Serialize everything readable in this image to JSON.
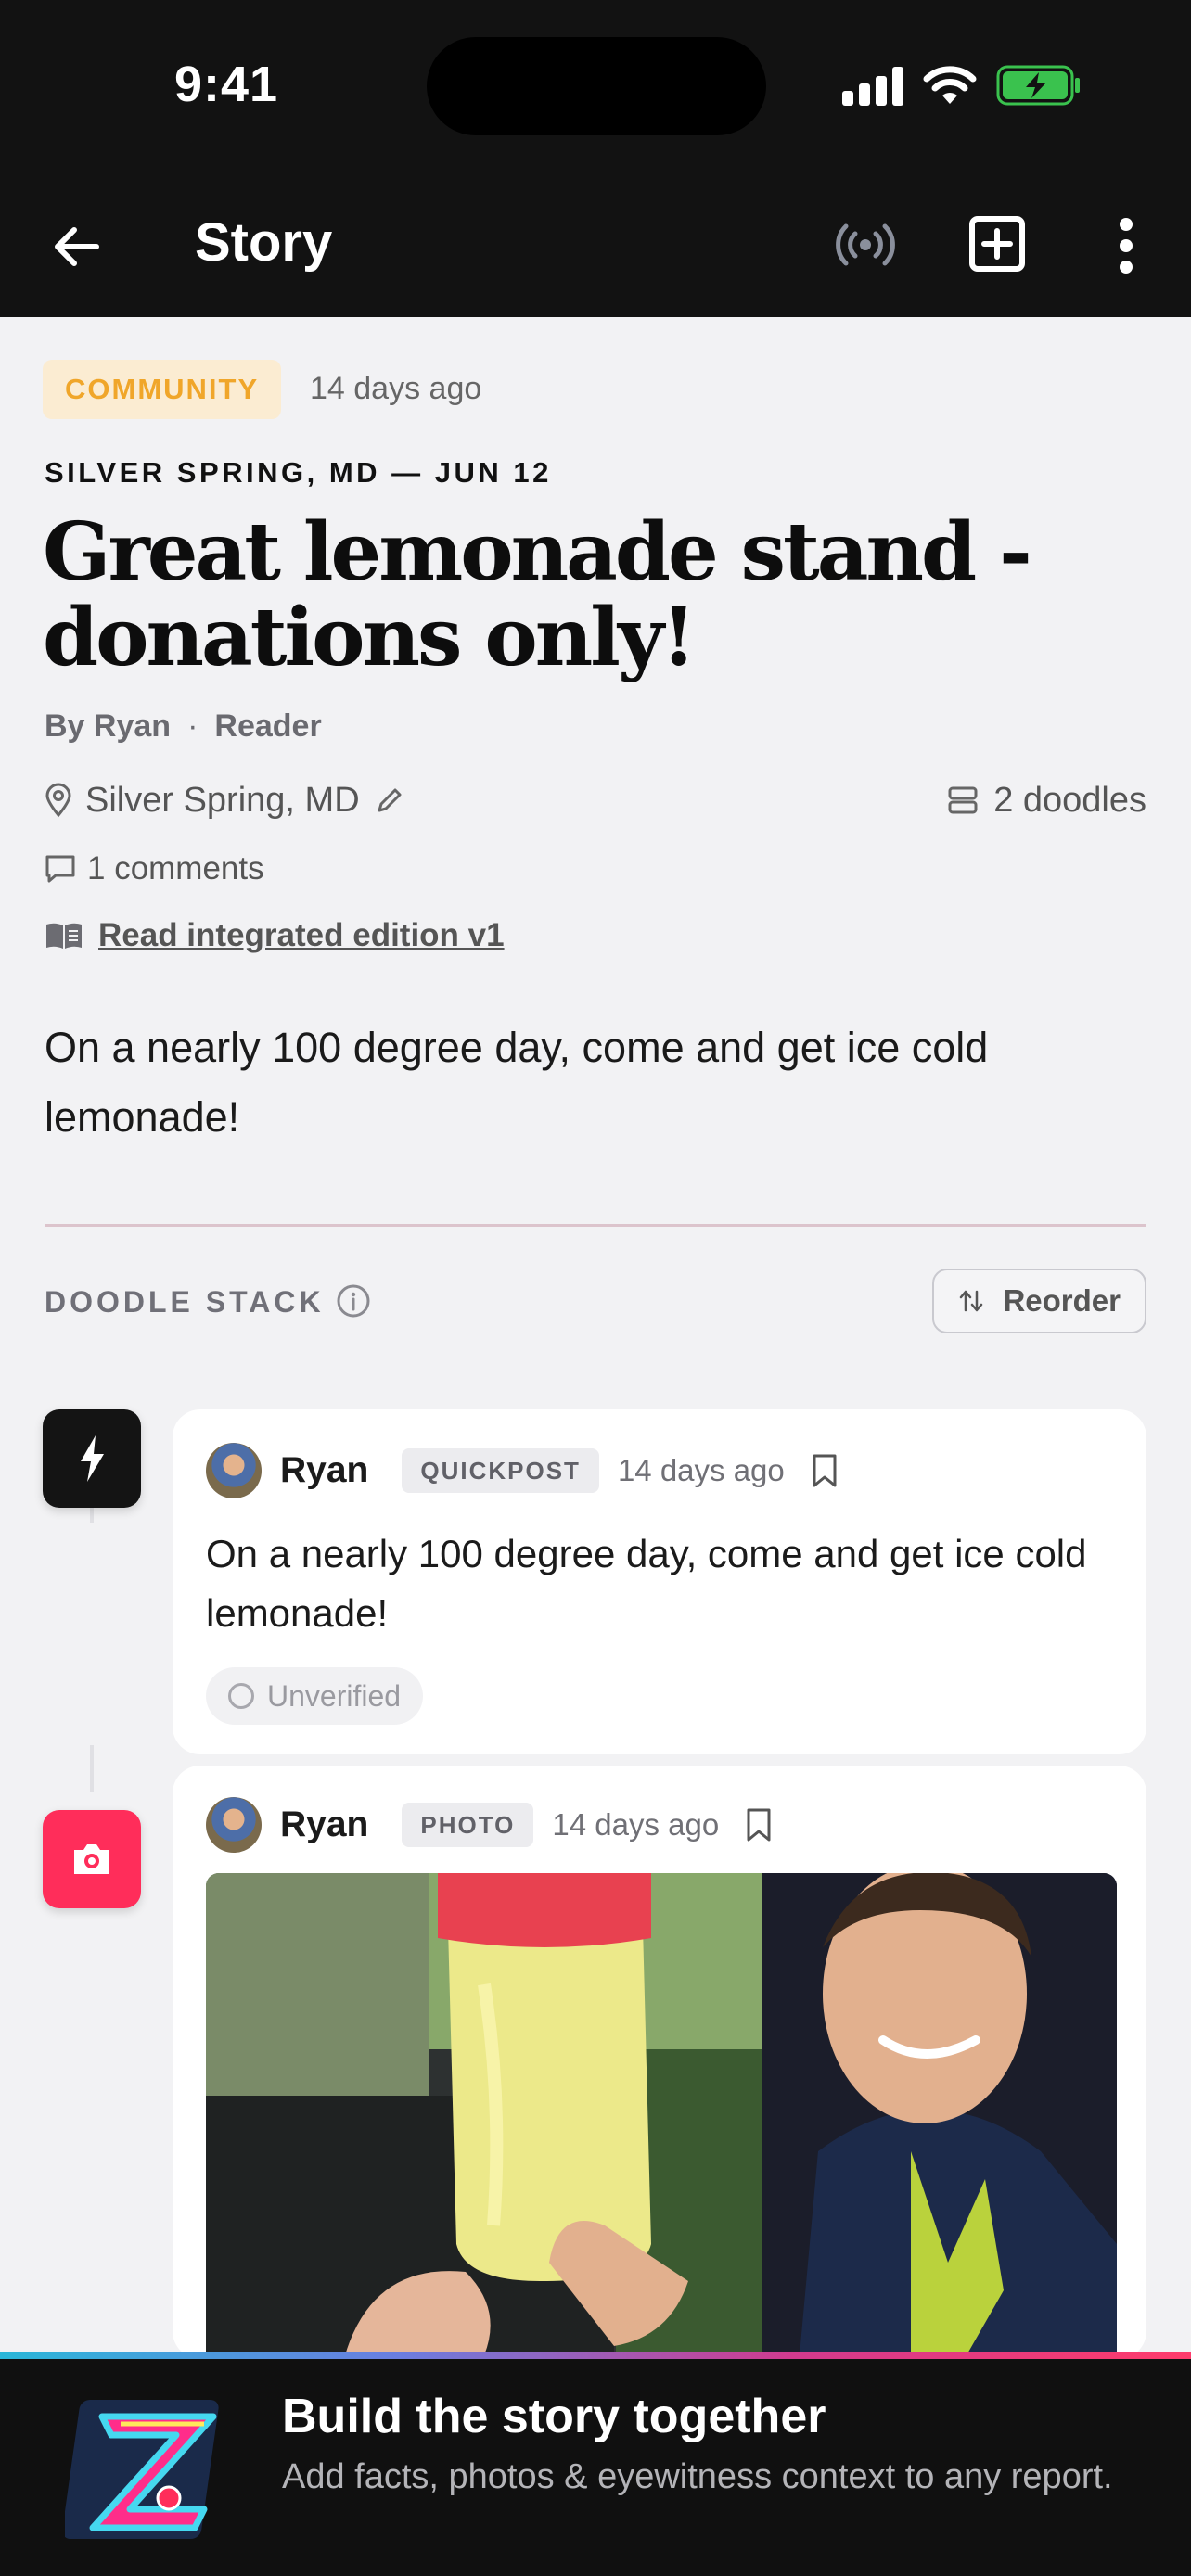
{
  "status_bar": {
    "time": "9:41"
  },
  "app_bar": {
    "title": "Story",
    "icons": [
      "back-arrow-icon",
      "live-broadcast-icon",
      "add-square-icon",
      "more-vertical-icon"
    ]
  },
  "story": {
    "category": "COMMUNITY",
    "posted_ago": "14 days ago",
    "dateline": "SILVER SPRING, MD — JUN 12",
    "headline": "Great lemonade stand - donations only!",
    "author": "By Ryan",
    "role": "Reader",
    "location": "Silver Spring, MD",
    "doodles": "2 doodles",
    "comments": "1 comments",
    "edition_link": "Read integrated edition v1",
    "summary": "On a nearly 100 degree day, come and get ice cold lemonade!"
  },
  "doodle_stack": {
    "label": "DOODLE STACK",
    "reorder_label": "Reorder",
    "cards": [
      {
        "author": "Ryan",
        "type": "QUICKPOST",
        "time": "14 days ago",
        "body": "On a nearly 100 degree day, come and get ice cold lemonade!",
        "verification": "Unverified",
        "rail_icon": "lightning-icon"
      },
      {
        "author": "Ryan",
        "type": "PHOTO",
        "time": "14 days ago",
        "rail_icon": "camera-icon"
      }
    ]
  },
  "banner": {
    "title": "Build the story together",
    "subtitle": "Add facts, photos & eyewitness context to any report."
  },
  "colors": {
    "bar_background": "#121212",
    "category_badge_bg": "#fbecd2",
    "category_badge_text": "#f0a62a",
    "photo_rail": "#ff2d5a",
    "page_background": "#f2f2f4"
  }
}
